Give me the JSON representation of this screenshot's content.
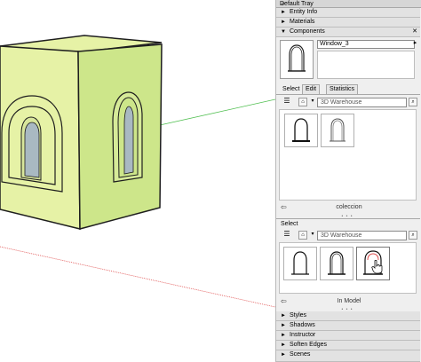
{
  "tray": {
    "title": "Default Tray",
    "pin": "⊿",
    "sections_top": [
      {
        "label": "Entity Info",
        "arrow": "►"
      },
      {
        "label": "Materials",
        "arrow": "►"
      },
      {
        "label": "Components",
        "arrow": "▼",
        "close": "✕"
      }
    ],
    "component_name": "Window_3",
    "tabs": [
      "Select",
      "Edit",
      "Statistics"
    ],
    "upper_browser": {
      "search_placeholder": "3D Warehouse",
      "collection_label": "coleccion"
    },
    "secondary": {
      "select_label": "Select",
      "search_placeholder": "3D Warehouse",
      "collection_label": "In Model"
    },
    "sections_bottom": [
      {
        "label": "Styles",
        "arrow": "►"
      },
      {
        "label": "Shadows",
        "arrow": "►"
      },
      {
        "label": "Instructor",
        "arrow": "►"
      },
      {
        "label": "Soften Edges",
        "arrow": "►"
      },
      {
        "label": "Scenes",
        "arrow": "►"
      }
    ]
  },
  "icons": {
    "view_options": "☰",
    "home": "⌂",
    "dropdown": "▾",
    "search": "⌕",
    "details": "▸",
    "nav_back": "⇦",
    "close": "✕"
  },
  "colors": {
    "wall_front": "#e6f2a6",
    "wall_side": "#cde68a",
    "glass": "#a9b9c2",
    "axis_green": "#4fbf4f",
    "axis_red": "#e05050"
  }
}
